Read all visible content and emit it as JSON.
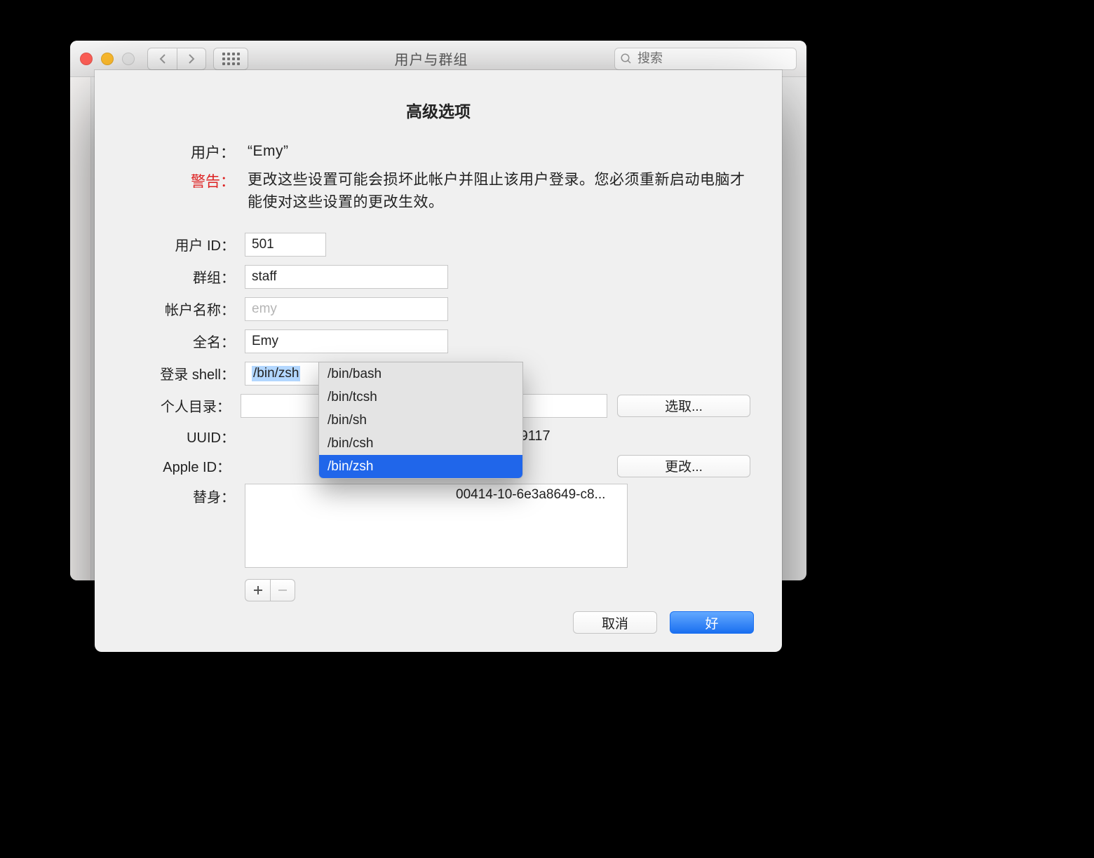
{
  "window": {
    "title": "用户与群组",
    "search_placeholder": "搜索"
  },
  "sheet": {
    "title": "高级选项",
    "user_label": "用户：",
    "user_value": "“Emy”",
    "warning_label": "警告：",
    "warning_text": "更改这些设置可能会损坏此帐户并阻止该用户登录。您必须重新启动电脑才能使对这些设置的更改生效。",
    "fields": {
      "user_id_label": "用户 ID：",
      "user_id_value": "501",
      "group_label": "群组：",
      "group_value": "staff",
      "account_name_label": "帐户名称：",
      "account_name_value": "emy",
      "full_name_label": "全名：",
      "full_name_value": "Emy",
      "login_shell_label": "登录 shell：",
      "login_shell_value": "/bin/zsh",
      "home_dir_label": "个人目录：",
      "home_dir_button": "选取...",
      "uuid_label": "UUID：",
      "uuid_value_partial": "688C67C79117",
      "apple_id_label": "Apple ID：",
      "apple_id_button": "更改...",
      "aliases_label": "替身：",
      "aliases_first": "00414-10-6e3a8649-c8..."
    },
    "shell_options": [
      "/bin/bash",
      "/bin/tcsh",
      "/bin/sh",
      "/bin/csh",
      "/bin/zsh"
    ],
    "shell_selected": "/bin/zsh",
    "cancel": "取消",
    "ok": "好"
  }
}
